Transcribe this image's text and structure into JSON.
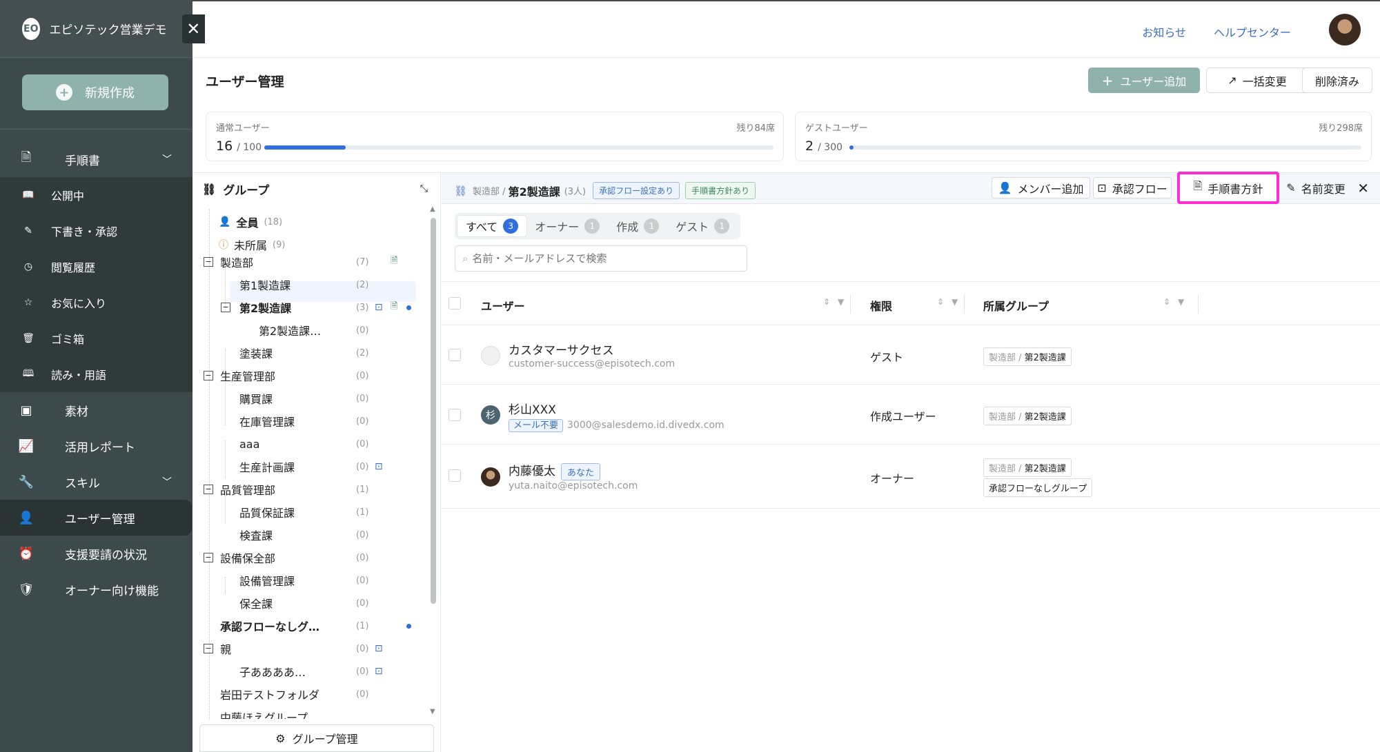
{
  "sidebar": {
    "org": "エピソテック営業デモ",
    "logo_text": "EO",
    "new_button": "新規作成",
    "sections": [
      {
        "label": "手順書",
        "icon": "document-icon"
      },
      {
        "label": "素材",
        "icon": "image-icon"
      },
      {
        "label": "活用レポート",
        "icon": "chart-icon"
      },
      {
        "label": "スキル",
        "icon": "wrench-icon"
      },
      {
        "label": "ユーザー管理",
        "icon": "users-icon"
      },
      {
        "label": "支援要請の状況",
        "icon": "alarm-icon"
      },
      {
        "label": "オーナー向け機能",
        "icon": "shield-icon"
      }
    ],
    "subitems": [
      {
        "label": "公開中"
      },
      {
        "label": "下書き・承認"
      },
      {
        "label": "閲覧履歴"
      },
      {
        "label": "お気に入り"
      },
      {
        "label": "ゴミ箱"
      },
      {
        "label": "読み・用語"
      }
    ]
  },
  "topbar": {
    "notice": "お知らせ",
    "help": "ヘルプセンター"
  },
  "page": {
    "title": "ユーザー管理",
    "add_user": "ユーザー追加",
    "bulk_change": "一括変更",
    "deleted": "削除済み"
  },
  "quota": {
    "normal": {
      "label": "通常ユーザー",
      "used": "16",
      "total": "/ 100",
      "remaining": "残り84席",
      "fraction": 0.16
    },
    "guest": {
      "label": "ゲストユーザー",
      "used": "2",
      "total": "/ 300",
      "remaining": "残り298席",
      "fraction": 0.0067
    }
  },
  "groups": {
    "title": "グループ",
    "footer": "グループ管理",
    "all": {
      "label": "全員",
      "count": "(18)"
    },
    "unassigned": {
      "label": "未所属",
      "count": "(9)"
    },
    "tree": [
      {
        "label": "製造部",
        "count": "(7)"
      },
      {
        "label": "第1製造課",
        "count": "(2)"
      },
      {
        "label": "第2製造課",
        "count": "(3)"
      },
      {
        "label": "第2製造課…",
        "count": "(0)"
      },
      {
        "label": "塗装課",
        "count": "(2)"
      },
      {
        "label": "生産管理部",
        "count": "(0)"
      },
      {
        "label": "購買課",
        "count": "(0)"
      },
      {
        "label": "在庫管理課",
        "count": "(0)"
      },
      {
        "label": "aaa",
        "count": "(0)"
      },
      {
        "label": "生産計画課",
        "count": "(0)"
      },
      {
        "label": "品質管理部",
        "count": "(1)"
      },
      {
        "label": "品質保証課",
        "count": "(1)"
      },
      {
        "label": "検査課",
        "count": "(0)"
      },
      {
        "label": "設備保全部",
        "count": "(0)"
      },
      {
        "label": "設備管理課",
        "count": "(0)"
      },
      {
        "label": "保全課",
        "count": "(0)"
      },
      {
        "label": "承認フローなしグ…",
        "count": "(1)"
      },
      {
        "label": "親",
        "count": "(0)"
      },
      {
        "label": "子ああああ…",
        "count": "(0)"
      },
      {
        "label": "岩田テストフォルダ",
        "count": "(0)"
      },
      {
        "label": "中藤ほえグループ",
        "count": ""
      }
    ]
  },
  "detail": {
    "parent": "製造部 /",
    "name": "第2製造課",
    "count": "(3人)",
    "tag_flow": "承認フロー設定あり",
    "tag_policy": "手順書方針あり",
    "add_member": "メンバー追加",
    "approval_flow": "承認フロー",
    "policy": "手順書方針",
    "rename": "名前変更"
  },
  "tabs": [
    {
      "label": "すべて",
      "count": "3"
    },
    {
      "label": "オーナー",
      "count": "1"
    },
    {
      "label": "作成",
      "count": "1"
    },
    {
      "label": "ゲスト",
      "count": "1"
    }
  ],
  "search": {
    "placeholder": "名前・メールアドレスで検索"
  },
  "table": {
    "headers": {
      "user": "ユーザー",
      "role": "権限",
      "group": "所属グループ"
    },
    "rows": [
      {
        "name": "カスタマーサクセス",
        "email": "customer-success@episotech.com",
        "role": "ゲスト",
        "groups": [
          {
            "parent": "製造部 / ",
            "name": "第2製造課"
          }
        ]
      },
      {
        "name": "杉山XXX",
        "avatar_text": "杉",
        "badge": "メール不要",
        "email": "3000@salesdemo.id.divedx.com",
        "role": "作成ユーザー",
        "groups": [
          {
            "parent": "製造部 / ",
            "name": "第2製造課"
          }
        ]
      },
      {
        "name": "内藤優太",
        "you": "あなた",
        "email": "yuta.naito@episotech.com",
        "role": "オーナー",
        "groups": [
          {
            "parent": "製造部 / ",
            "name": "第2製造課"
          },
          {
            "parent": "",
            "name": "承認フローなしグループ"
          }
        ]
      }
    ]
  },
  "colors": {
    "sidebar": "#3d4a4b",
    "accent": "#2f6fe0",
    "primary_button": "#8fb2ad",
    "highlight": "#ff2bd6"
  }
}
